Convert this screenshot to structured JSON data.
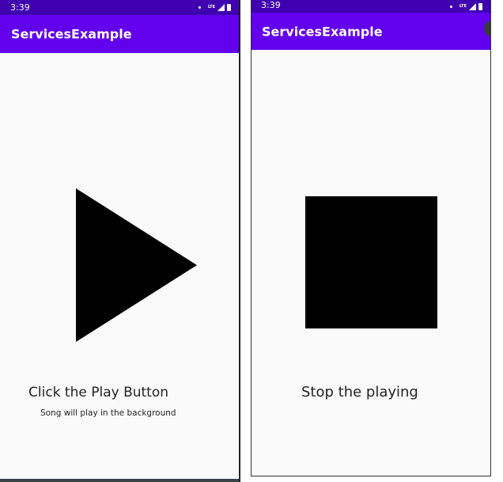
{
  "screens": [
    {
      "status_time": "3:39",
      "app_title": "ServicesExample",
      "caption": "Click the Play Button",
      "subcaption": "Song will play in the background",
      "button_icon": "play-icon"
    },
    {
      "status_time": "3:39",
      "app_title": "ServicesExample",
      "caption": "Stop the playing",
      "button_icon": "stop-icon"
    }
  ],
  "status_icons": [
    "dot-icon",
    "lte-icon",
    "signal-icon",
    "battery-icon"
  ],
  "lte_label": "LTE",
  "colors": {
    "status_bar": "#3f00b0",
    "app_bar": "#6200ee",
    "background": "#fafafa",
    "icon": "#000000"
  }
}
